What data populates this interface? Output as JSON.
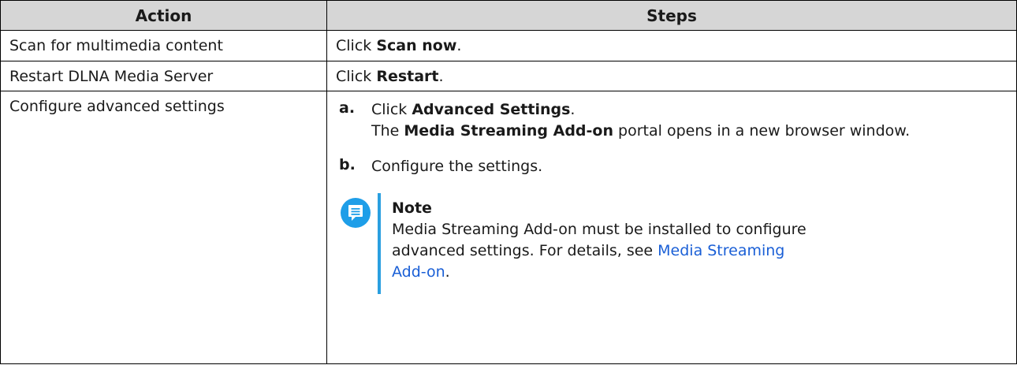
{
  "table": {
    "headers": [
      "Action",
      "Steps"
    ],
    "rows": [
      {
        "action": "Scan for multimedia content",
        "steps": {
          "prefix": "Click ",
          "bold": "Scan now",
          "suffix": "."
        }
      },
      {
        "action": "Restart DLNA Media Server",
        "steps": {
          "prefix": "Click ",
          "bold": "Restart",
          "suffix": "."
        }
      },
      {
        "action": "Configure advanced settings",
        "step_a": {
          "letter": "a.",
          "prefix": "Click ",
          "bold": "Advanced Settings",
          "suffix": ".",
          "line2_prefix": "The ",
          "line2_bold": "Media Streaming Add-on",
          "line2_suffix": " portal opens in a new browser window."
        },
        "step_b": {
          "letter": "b.",
          "text": "Configure the settings."
        },
        "note": {
          "icon": "note-icon",
          "title": "Note",
          "text": "Media Streaming Add-on must be installed to configure advanced settings. For details, see ",
          "link": "Media Streaming Add-on",
          "suffix": "."
        }
      }
    ]
  },
  "colors": {
    "header_bg": "#d6d6d6",
    "note_icon": "#1e9ee8",
    "link": "#1a5fd6"
  }
}
